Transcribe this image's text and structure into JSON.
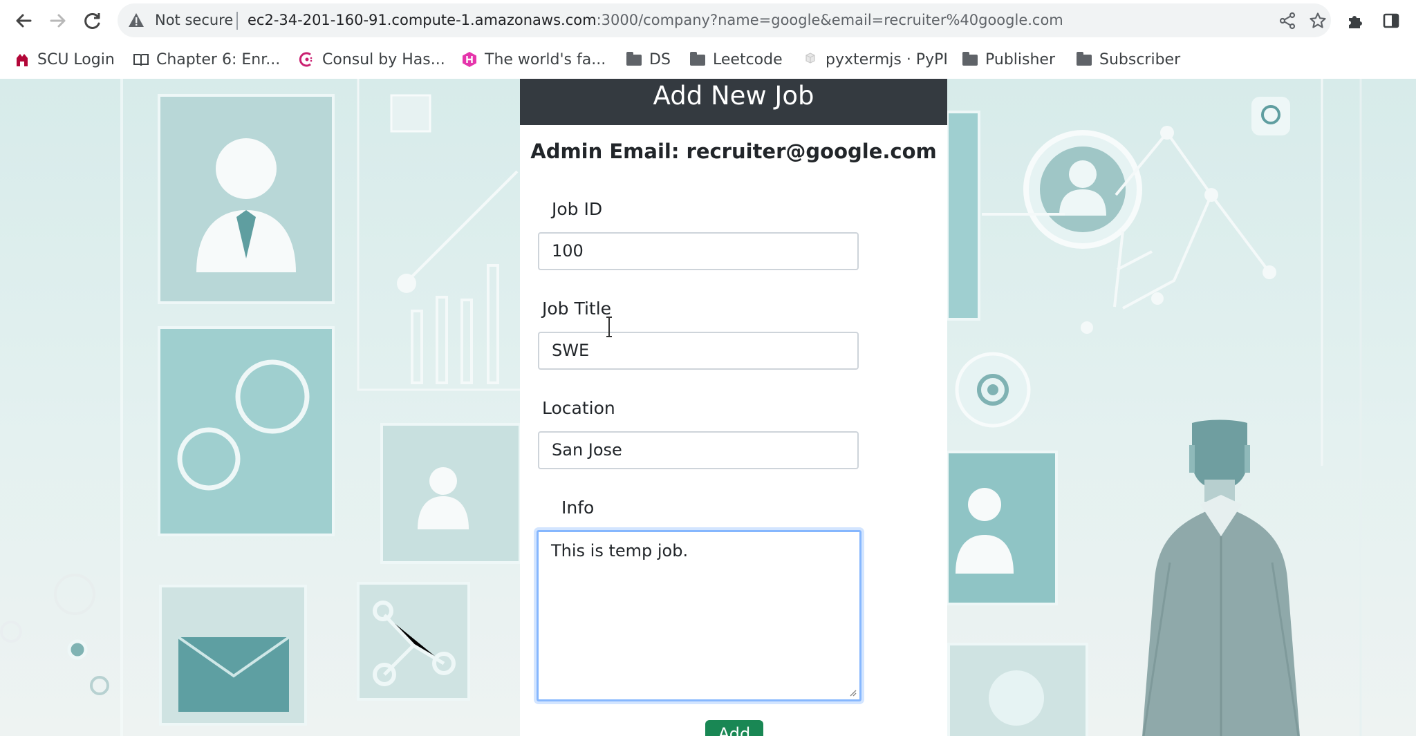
{
  "browser": {
    "security_label": "Not secure",
    "url_host": "ec2-34-201-160-91.compute-1.amazonaws.com",
    "url_rest": ":3000/company?name=google&email=recruiter%40google.com",
    "icons": {
      "back": "arrow-left-icon",
      "forward": "arrow-right-icon",
      "reload": "reload-icon",
      "warning": "warning-triangle-icon",
      "share": "share-icon",
      "bookmark": "star-icon",
      "extensions": "puzzle-icon",
      "side_panel": "side-panel-icon"
    }
  },
  "bookmarks": [
    {
      "label": "SCU Login",
      "icon": "scu-logo-icon"
    },
    {
      "label": "Chapter 6: Enr...",
      "icon": "book-icon"
    },
    {
      "label": "Consul by Has...",
      "icon": "consul-logo-icon"
    },
    {
      "label": "The world's fa...",
      "icon": "hexagon-logo-icon"
    },
    {
      "label": "DS",
      "icon": "folder-icon"
    },
    {
      "label": "Leetcode",
      "icon": "folder-icon"
    },
    {
      "label": "pyxtermjs · PyPI",
      "icon": "pypi-icon"
    },
    {
      "label": "Publisher",
      "icon": "folder-icon"
    },
    {
      "label": "Subscriber",
      "icon": "folder-icon"
    }
  ],
  "form": {
    "header": "Add New Job",
    "admin_email": "Admin Email: recruiter@google.com",
    "job_id_label": "Job ID",
    "job_id_value": "100",
    "job_title_label": "Job Title",
    "job_title_value": "SWE",
    "location_label": "Location",
    "location_value": "San Jose",
    "info_label": "Info",
    "info_value": "This is temp job.",
    "submit_label": "Add"
  },
  "colors": {
    "header_bg": "#343a40",
    "submit_bg": "#198754",
    "focus_ring": "#86b7fe"
  }
}
